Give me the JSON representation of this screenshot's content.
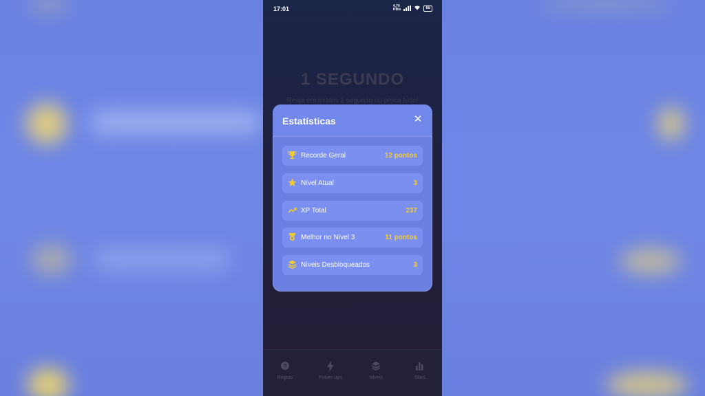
{
  "status_bar": {
    "time": "17:01",
    "network": "4,74\nKB/s",
    "battery": "65"
  },
  "background_screen": {
    "title": "1 SEGUNDO",
    "subtitle": "Reaja em exatos 1 segundo ou perca tudo!"
  },
  "modal": {
    "title": "Estatísticas",
    "close_icon": "close-icon",
    "rows": [
      {
        "icon": "trophy-icon",
        "label": "Recorde Geral",
        "value": "12 pontos"
      },
      {
        "icon": "star-icon",
        "label": "Nível Atual",
        "value": "3"
      },
      {
        "icon": "trending-up-icon",
        "label": "XP Total",
        "value": "237"
      },
      {
        "icon": "medal-icon",
        "label": "Melhor no Nível 3",
        "value": "11 pontos"
      },
      {
        "icon": "layers-icon",
        "label": "Níveis Desbloqueados",
        "value": "3"
      }
    ]
  },
  "tabbar": {
    "tabs": [
      {
        "icon": "help-icon",
        "label": "Regras"
      },
      {
        "icon": "bolt-icon",
        "label": "Power-ups"
      },
      {
        "icon": "layers-icon",
        "label": "Níveis"
      },
      {
        "icon": "bar-chart-icon",
        "label": "Stats"
      }
    ]
  },
  "colors": {
    "accent": "#f5cf2d",
    "modal_bg": "#6b7fe1",
    "page_bg": "#1e2242"
  }
}
